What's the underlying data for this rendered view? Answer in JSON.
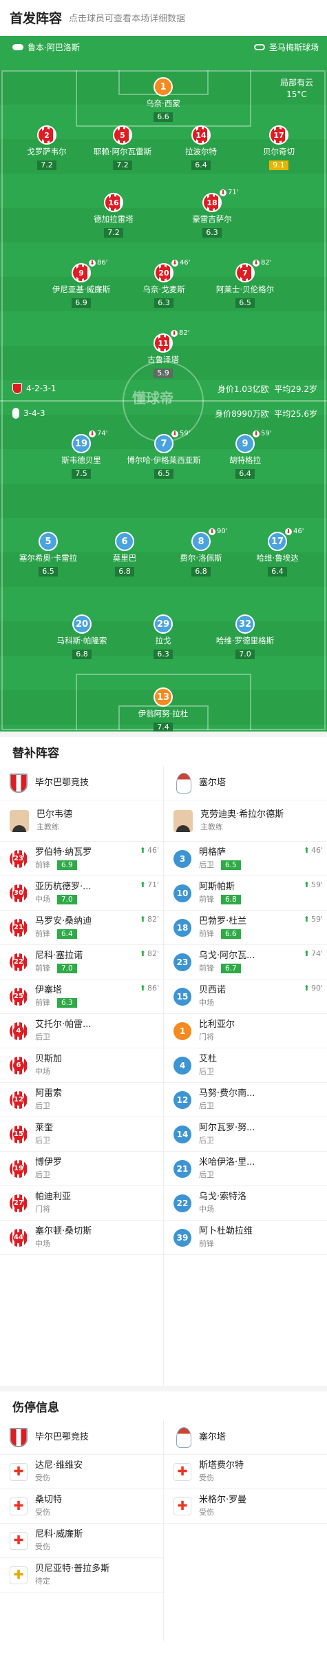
{
  "header": {
    "title": "首发阵容",
    "subtitle": "点击球员可查看本场详细数据"
  },
  "teams": {
    "home": "鲁本·阿巴洛斯",
    "away": "圣马梅斯球场"
  },
  "weather": {
    "line1": "局部有云",
    "line2": "15°C"
  },
  "watermark": "懂球帝",
  "home_info": {
    "formation": "4-2-3-1",
    "value": "身价1.03亿欧",
    "age": "平均29.2岁"
  },
  "away_info": {
    "formation": "3-4-3",
    "value": "身价8990万欧",
    "age": "平均25.6岁"
  },
  "pitch_players": [
    {
      "no": "1",
      "name": "乌奈·西蒙",
      "rating": "6.6",
      "kit": "gk1"
    },
    {
      "no": "2",
      "name": "戈罗萨韦尔",
      "rating": "7.2",
      "kit": "ath"
    },
    {
      "no": "5",
      "name": "耶赖·阿尔瓦雷斯",
      "rating": "7.2",
      "kit": "ath"
    },
    {
      "no": "14",
      "name": "拉波尔特",
      "rating": "6.4",
      "kit": "ath"
    },
    {
      "no": "17",
      "name": "贝尔奇切",
      "rating": "9.1",
      "kit": "ath"
    },
    {
      "no": "16",
      "name": "德加拉雷塔",
      "rating": "7.2",
      "kit": "ath"
    },
    {
      "no": "18",
      "name": "豪雷吉萨尔",
      "rating": "6.3",
      "kit": "ath",
      "sub": "71'"
    },
    {
      "no": "9",
      "name": "伊尼亚基·威廉斯",
      "rating": "6.9",
      "kit": "ath",
      "sub": "86'"
    },
    {
      "no": "20",
      "name": "乌奈·戈麦斯",
      "rating": "6.3",
      "kit": "ath",
      "sub": "46'"
    },
    {
      "no": "7",
      "name": "阿莱士·贝伦格尔",
      "rating": "6.5",
      "kit": "ath",
      "sub": "82'"
    },
    {
      "no": "11",
      "name": "古鲁泽塔",
      "rating": "5.9",
      "kit": "ath",
      "sub": "82'"
    },
    {
      "no": "19",
      "name": "斯韦德贝里",
      "rating": "7.5",
      "kit": "cel",
      "sub": "74'"
    },
    {
      "no": "7",
      "name": "博尔哈·伊格莱西亚斯",
      "rating": "6.5",
      "kit": "cel",
      "sub": "59'"
    },
    {
      "no": "9",
      "name": "胡特格拉",
      "rating": "6.4",
      "kit": "cel",
      "sub": "59'"
    },
    {
      "no": "5",
      "name": "塞尔希奥·卡雷拉",
      "rating": "6.5",
      "kit": "cel"
    },
    {
      "no": "6",
      "name": "莫里巴",
      "rating": "6.8",
      "kit": "cel"
    },
    {
      "no": "8",
      "name": "费尔·洛佩斯",
      "rating": "6.8",
      "kit": "cel",
      "sub": "90'"
    },
    {
      "no": "17",
      "name": "哈维·鲁埃达",
      "rating": "6.4",
      "kit": "cel",
      "sub": "46'"
    },
    {
      "no": "20",
      "name": "马科斯·帕隆索",
      "rating": "6.8",
      "kit": "cel"
    },
    {
      "no": "29",
      "name": "拉戈",
      "rating": "6.3",
      "kit": "cel"
    },
    {
      "no": "32",
      "name": "哈维·罗德里格斯",
      "rating": "7.0",
      "kit": "cel"
    },
    {
      "no": "13",
      "name": "伊翁阿努·拉杜",
      "rating": "7.4",
      "kit": "gk2"
    }
  ],
  "subs_title": "替补阵容",
  "subs": {
    "home_team": "毕尔巴鄂竞技",
    "away_team": "塞尔塔",
    "home_coach": {
      "name": "巴尔韦德",
      "role": "主教练"
    },
    "away_coach": {
      "name": "克劳迪奥·希拉尔德斯",
      "role": "主教练"
    },
    "home": [
      {
        "no": "23",
        "name": "罗伯特·纳瓦罗",
        "pos": "前锋",
        "rating": "6.9",
        "min": "46'"
      },
      {
        "no": "30",
        "name": "亚历杭德罗·...",
        "pos": "中场",
        "rating": "7.0",
        "min": "71'"
      },
      {
        "no": "21",
        "name": "马罗安·桑纳迪",
        "pos": "前锋",
        "rating": "6.4",
        "min": "82'"
      },
      {
        "no": "22",
        "name": "尼科·塞拉诺",
        "pos": "前锋",
        "rating": "7.0",
        "min": "82'"
      },
      {
        "no": "25",
        "name": "伊塞塔",
        "pos": "前锋",
        "rating": "6.3",
        "min": "86'"
      },
      {
        "no": "4",
        "name": "艾托尔·帕雷...",
        "pos": "后卫"
      },
      {
        "no": "6",
        "name": "贝斯加",
        "pos": "中场"
      },
      {
        "no": "12",
        "name": "阿雷索",
        "pos": "后卫"
      },
      {
        "no": "15",
        "name": "莱奎",
        "pos": "后卫"
      },
      {
        "no": "19",
        "name": "博伊罗",
        "pos": "后卫"
      },
      {
        "no": "27",
        "name": "帕迪利亚",
        "pos": "门将"
      },
      {
        "no": "44",
        "name": "塞尔顿·桑切斯",
        "pos": "中场"
      }
    ],
    "away": [
      {
        "no": "3",
        "name": "明格萨",
        "pos": "后卫",
        "rating": "6.5",
        "min": "46'"
      },
      {
        "no": "10",
        "name": "阿斯帕斯",
        "pos": "前锋",
        "rating": "6.8",
        "min": "59'"
      },
      {
        "no": "18",
        "name": "巴勃罗·杜兰",
        "pos": "前锋",
        "rating": "6.6",
        "min": "59'"
      },
      {
        "no": "23",
        "name": "乌戈·阿尔瓦...",
        "pos": "前锋",
        "rating": "6.7",
        "min": "74'"
      },
      {
        "no": "15",
        "name": "贝西诺",
        "pos": "中场",
        "min": "90'"
      },
      {
        "no": "1",
        "name": "比利亚尔",
        "pos": "门将"
      },
      {
        "no": "4",
        "name": "艾杜",
        "pos": "后卫"
      },
      {
        "no": "12",
        "name": "马努·费尔南...",
        "pos": "后卫"
      },
      {
        "no": "14",
        "name": "阿尔瓦罗·努...",
        "pos": "后卫"
      },
      {
        "no": "21",
        "name": "米哈伊洛·里...",
        "pos": "后卫"
      },
      {
        "no": "22",
        "name": "乌戈·索特洛",
        "pos": "中场"
      },
      {
        "no": "39",
        "name": "阿卜杜勒拉维",
        "pos": "前锋"
      }
    ]
  },
  "injury_title": "伤停信息",
  "injury": {
    "home": [
      {
        "name": "达尼·维维安",
        "status": "受伤"
      },
      {
        "name": "桑切特",
        "status": "受伤"
      },
      {
        "name": "尼科·威廉斯",
        "status": "受伤"
      },
      {
        "name": "贝尼亚特·普拉多斯",
        "status": "待定"
      }
    ],
    "away": [
      {
        "name": "斯塔费尔特",
        "status": "受伤"
      },
      {
        "name": "米格尔·罗曼",
        "status": "受伤"
      }
    ]
  }
}
